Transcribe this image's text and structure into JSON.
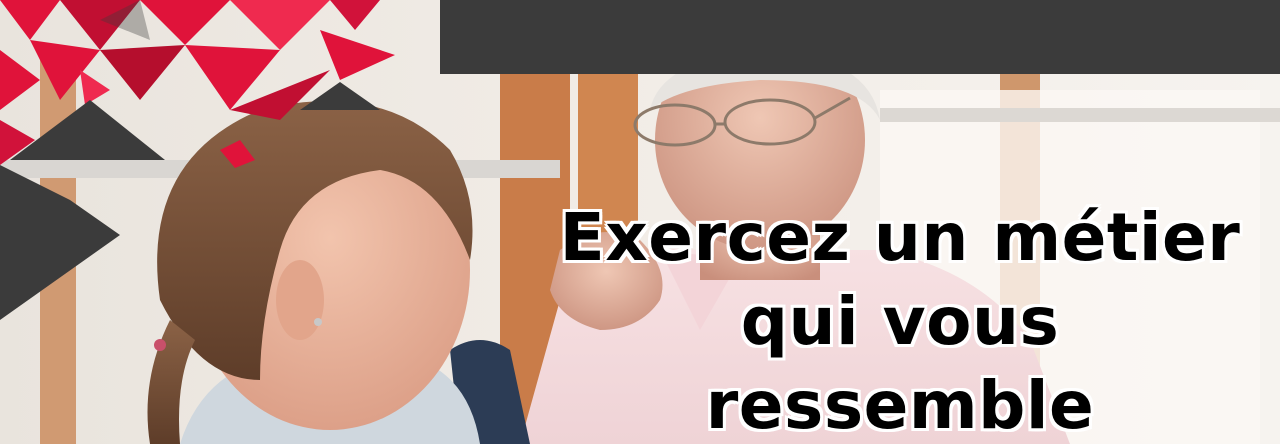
{
  "banner": {
    "headline": {
      "line1": "Exercez un métier",
      "line2": "qui vous ressemble"
    }
  },
  "colors": {
    "accent_red": "#e0133a",
    "dark_gray": "#3b3b3b"
  }
}
